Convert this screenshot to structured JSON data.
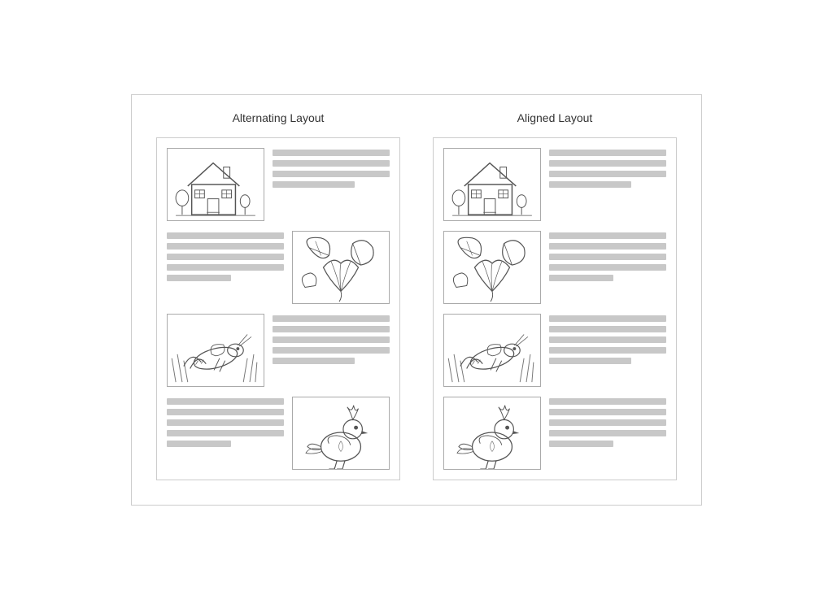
{
  "layouts": [
    {
      "id": "alternating",
      "title": "Alternating Layout",
      "rows": [
        {
          "imagePos": "left",
          "imageId": "house",
          "lines": [
            "full",
            "full",
            "full",
            "short"
          ]
        },
        {
          "imagePos": "right",
          "imageId": "leaves",
          "lines": [
            "full",
            "full",
            "full",
            "full",
            "shorter"
          ]
        },
        {
          "imagePos": "left",
          "imageId": "grasshopper",
          "lines": [
            "full",
            "full",
            "full",
            "full",
            "short"
          ]
        },
        {
          "imagePos": "right",
          "imageId": "quail",
          "lines": [
            "full",
            "full",
            "full",
            "full",
            "shorter"
          ]
        }
      ]
    },
    {
      "id": "aligned",
      "title": "Aligned Layout",
      "rows": [
        {
          "imagePos": "left",
          "imageId": "house",
          "lines": [
            "full",
            "full",
            "full",
            "short"
          ]
        },
        {
          "imagePos": "left",
          "imageId": "leaves",
          "lines": [
            "full",
            "full",
            "full",
            "full",
            "shorter"
          ]
        },
        {
          "imagePos": "left",
          "imageId": "grasshopper",
          "lines": [
            "full",
            "full",
            "full",
            "full",
            "short"
          ]
        },
        {
          "imagePos": "left",
          "imageId": "quail",
          "lines": [
            "full",
            "full",
            "full",
            "full",
            "shorter"
          ]
        }
      ]
    }
  ]
}
